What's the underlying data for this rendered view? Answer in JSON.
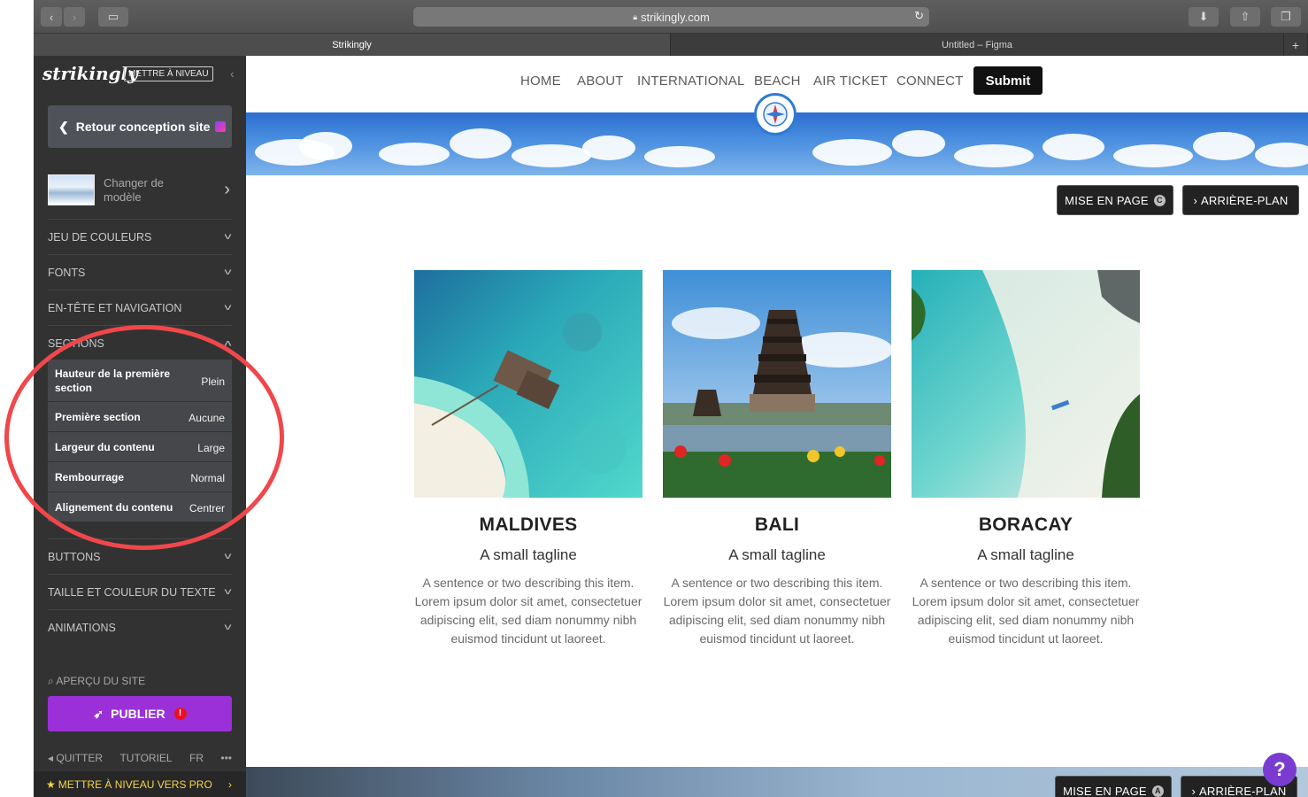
{
  "browser": {
    "url": "strikingly.com",
    "tabs": [
      {
        "label": "Strikingly"
      },
      {
        "label": "Untitled – Figma"
      }
    ]
  },
  "sidebar": {
    "logo": "strikingly",
    "upgrade_badge": "METTRE À NIVEAU",
    "back_button": "Retour conception site",
    "template_label": "Changer de modèle",
    "sections": [
      {
        "label": "JEU DE COULEURS"
      },
      {
        "label": "FONTS"
      },
      {
        "label": "EN-TÊTE ET NAVIGATION"
      },
      {
        "label": "SECTIONS"
      },
      {
        "label": "BUTTONS"
      },
      {
        "label": "TAILLE ET COULEUR DU TEXTE"
      },
      {
        "label": "ANIMATIONS"
      }
    ],
    "section_settings": [
      {
        "key": "Hauteur de la première section",
        "value": "Plein"
      },
      {
        "key": "Première section",
        "value": "Aucune"
      },
      {
        "key": "Largeur du contenu",
        "value": "Large"
      },
      {
        "key": "Rembourrage",
        "value": "Normal"
      },
      {
        "key": "Alignement du contenu",
        "value": "Centrer"
      }
    ],
    "preview": "APERÇU DU SITE",
    "publish": "PUBLIER",
    "footer": {
      "quit": "QUITTER",
      "tutorial": "TUTORIEL",
      "lang": "FR",
      "more": "•••"
    },
    "pro_upgrade": "METTRE À NIVEAU VERS PRO"
  },
  "site": {
    "nav": [
      "HOME",
      "ABOUT",
      "INTERNATIONAL",
      "BEACH",
      "AIR TICKET",
      "CONNECT"
    ],
    "submit": "Submit",
    "editor_buttons": {
      "layout_label": "MISE EN PAGE",
      "layout_badge": "C",
      "background_label": "ARRIÈRE-PLAN",
      "layout_badge_bottom": "A"
    },
    "cards": [
      {
        "title": "MALDIVES",
        "tagline": "A small tagline",
        "description": "A sentence or two describing this item. Lorem ipsum dolor sit amet, consectetuer adipiscing elit, sed diam nonummy nibh euismod tincidunt ut laoreet."
      },
      {
        "title": "BALI",
        "tagline": "A small tagline",
        "description": "A sentence or two describing this item. Lorem ipsum dolor sit amet, consectetuer adipiscing elit, sed diam nonummy nibh euismod tincidunt ut laoreet."
      },
      {
        "title": "BORACAY",
        "tagline": "A small tagline",
        "description": "A sentence or two describing this item. Lorem ipsum dolor sit amet, consectetuer adipiscing elit, sed diam nonummy nibh euismod tincidunt ut laoreet."
      }
    ],
    "help": "?"
  },
  "colors": {
    "sidebar_bg": "#323232",
    "publish": "#9b30d9",
    "annotation": "#f0474b",
    "pro_text": "#f5d547"
  }
}
